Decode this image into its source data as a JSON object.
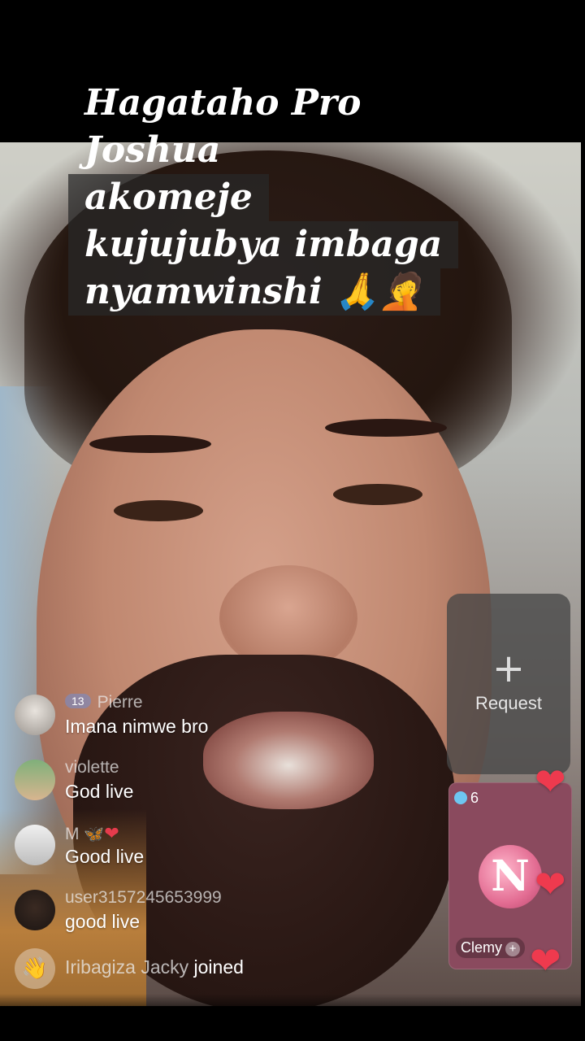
{
  "caption": {
    "lines": [
      "Hagataho Pro Joshua",
      "akomeje",
      "kujujubya imbaga",
      "nyamwinshi 🙏🤦"
    ]
  },
  "comments": [
    {
      "badge": "13",
      "name": "Pierre",
      "text": "Imana nimwe bro"
    },
    {
      "badge": "",
      "name": "violette",
      "text": "God live"
    },
    {
      "badge": "",
      "name": "M",
      "text": "Good live"
    },
    {
      "badge": "",
      "name": "user3157245653999",
      "text": "good live"
    }
  ],
  "joined": {
    "name": "Iribagiza Jacky",
    "action": "joined"
  },
  "request": {
    "icon": "plus-icon",
    "label": "Request"
  },
  "guest": {
    "count": "6",
    "avatar_letter": "N",
    "name": "Clemy"
  },
  "colors": {
    "heart": "#ee3a4e",
    "guest_bg": "#8a4a5e"
  }
}
